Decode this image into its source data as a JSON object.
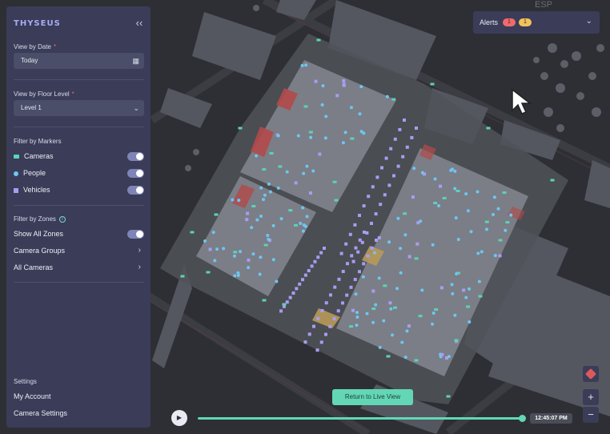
{
  "brand": "THYSEUS",
  "sidebar": {
    "date_label": "View by Date",
    "date_value": "Today",
    "floor_label": "View by Floor Level",
    "floor_value": "Level 1",
    "markers_label": "Filter by Markers",
    "markers": [
      {
        "label": "Cameras",
        "color": "#5cd3b6",
        "on": true
      },
      {
        "label": "People",
        "color": "#6ec6f2",
        "on": true
      },
      {
        "label": "Vehicles",
        "color": "#a99cf2",
        "on": true
      }
    ],
    "zones_label": "Filter by Zones",
    "show_all_zones": "Show All Zones",
    "camera_groups": "Camera Groups",
    "all_cameras": "All Cameras",
    "settings_label": "Settings",
    "my_account": "My Account",
    "camera_settings": "Camera Settings"
  },
  "alerts": {
    "label": "Alerts",
    "red_count": "1",
    "yellow_count": "1",
    "red_color": "#ef6b6b",
    "yellow_color": "#f0c35b"
  },
  "map": {
    "place_text": "ESP"
  },
  "playback": {
    "return_label": "Return to Live View",
    "time": "12:45:07 PM",
    "progress": 0.99
  },
  "zoom": {
    "in": "+",
    "out": "−"
  },
  "icons": {
    "collapse": "chevrons-left-icon",
    "calendar": "calendar-icon",
    "dropdown": "chevron-down-icon",
    "info": "info-icon",
    "play": "play-icon",
    "layers": "layers-icon"
  }
}
